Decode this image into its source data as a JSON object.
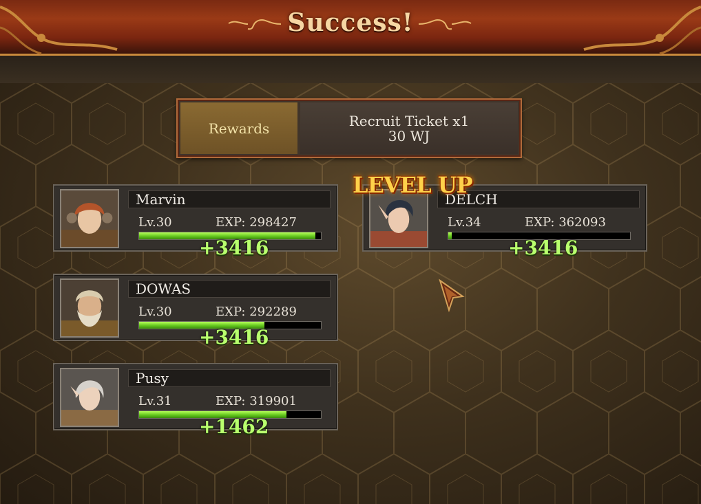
{
  "title": "Success!",
  "rewards": {
    "label": "Rewards",
    "line1": "Recruit Ticket x1",
    "line2": "30 WJ"
  },
  "level_up_text": "LEVEL UP",
  "characters": [
    {
      "name": "Marvin",
      "level": "Lv.30",
      "exp": "EXP: 298427",
      "exp_fraction": 0.97,
      "gain": "+3416",
      "hair": "#b4542a"
    },
    {
      "name": "DOWAS",
      "level": "Lv.30",
      "exp": "EXP: 292289",
      "exp_fraction": 0.69,
      "gain": "+3416",
      "hair": "#d9ccae"
    },
    {
      "name": "Pusy",
      "level": "Lv.31",
      "exp": "EXP: 319901",
      "exp_fraction": 0.81,
      "gain": "+1462",
      "hair": "#d6d2cc"
    },
    {
      "name": "DELCH",
      "level": "Lv.34",
      "exp": "EXP: 362093",
      "exp_fraction": 0.02,
      "gain": "+3416",
      "hair": "#2a3240"
    }
  ]
}
